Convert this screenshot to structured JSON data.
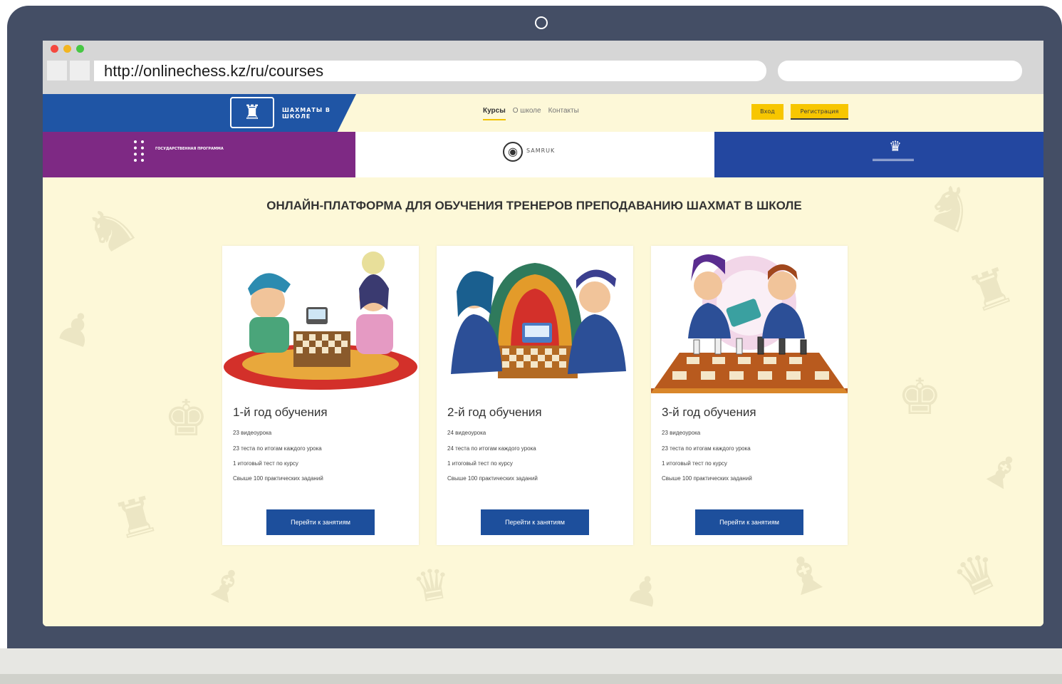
{
  "browser": {
    "url": "http://onlinechess.kz/ru/courses"
  },
  "header": {
    "logo_text": "ШАХМАТЫ В ШКОЛЕ",
    "nav": [
      {
        "label": "Курсы",
        "active": true
      },
      {
        "label": "О школе",
        "active": false
      },
      {
        "label": "Контакты",
        "active": false
      }
    ],
    "login_label": "Вход",
    "register_label": "Регистрация"
  },
  "partners": {
    "left_text": "ГОСУДАРСТВЕННАЯ ПРОГРАММА",
    "center_text": "SAMRUK"
  },
  "page_title": "ОНЛАЙН-ПЛАТФОРМА ДЛЯ ОБУЧЕНИЯ ТРЕНЕРОВ ПРЕПОДАВАНИЮ ШАХМАТ В ШКОЛЕ",
  "courses": [
    {
      "title": "1-й год обучения",
      "features": [
        "23 видеоурока",
        "23 теста по итогам каждого урока",
        "1 итоговый тест по курсу",
        "Свыше 100 практических заданий"
      ],
      "button": "Перейти к занятиям",
      "image_desc": "two kids playing chess on a carpet"
    },
    {
      "title": "2-й год обучения",
      "features": [
        "24 видеоурока",
        "24 теста по итогам каждого урока",
        "1 итоговый тест по курсу",
        "Свыше 100 практических заданий"
      ],
      "button": "Перейти к занятиям",
      "image_desc": "two students playing chess with a clock"
    },
    {
      "title": "3-й год обучения",
      "features": [
        "23 видеоурока",
        "23 теста по итогам каждого урока",
        "1 итоговый тест по курсу",
        "Свыше 100 практических заданий"
      ],
      "button": "Перейти к занятиям",
      "image_desc": "two students with a tablet over a chess board"
    }
  ],
  "colors": {
    "page_bg": "#fdf8d8",
    "header_blue": "#1f55a5",
    "partner_purple": "#7e2984",
    "partner_blue": "#2347a0",
    "accent_yellow": "#f7c600",
    "button_blue": "#1d4f9c",
    "frame": "#444e65"
  }
}
